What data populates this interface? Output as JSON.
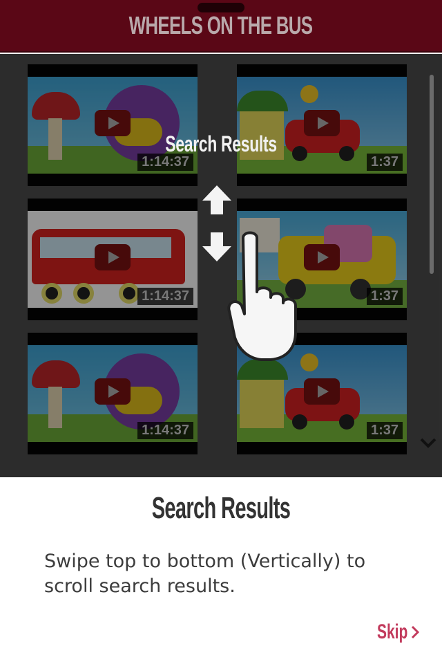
{
  "header": {
    "title": "WHEELS ON THE BUS"
  },
  "overlay": {
    "title": "Search Results",
    "gesture": "swipe-vertical-hand-icon"
  },
  "videos": [
    {
      "duration": "1:14:37",
      "theme": "mushroom-monster"
    },
    {
      "duration": "1:37",
      "theme": "red-car-house"
    },
    {
      "duration": "1:14:37",
      "theme": "red-bus-animals"
    },
    {
      "duration": "1:37",
      "theme": "yellow-bus-kids"
    },
    {
      "duration": "1:14:37",
      "theme": "mushroom-monster"
    },
    {
      "duration": "1:37",
      "theme": "red-car-house"
    }
  ],
  "panel": {
    "title": "Search Results",
    "body": "Swipe top to bottom (Vertically) to scroll search results.",
    "skip_label": "Skip"
  },
  "colors": {
    "header_bg": "#5a0716",
    "skip": "#c23a5c",
    "dim_overlay": "#4d4d4d"
  }
}
